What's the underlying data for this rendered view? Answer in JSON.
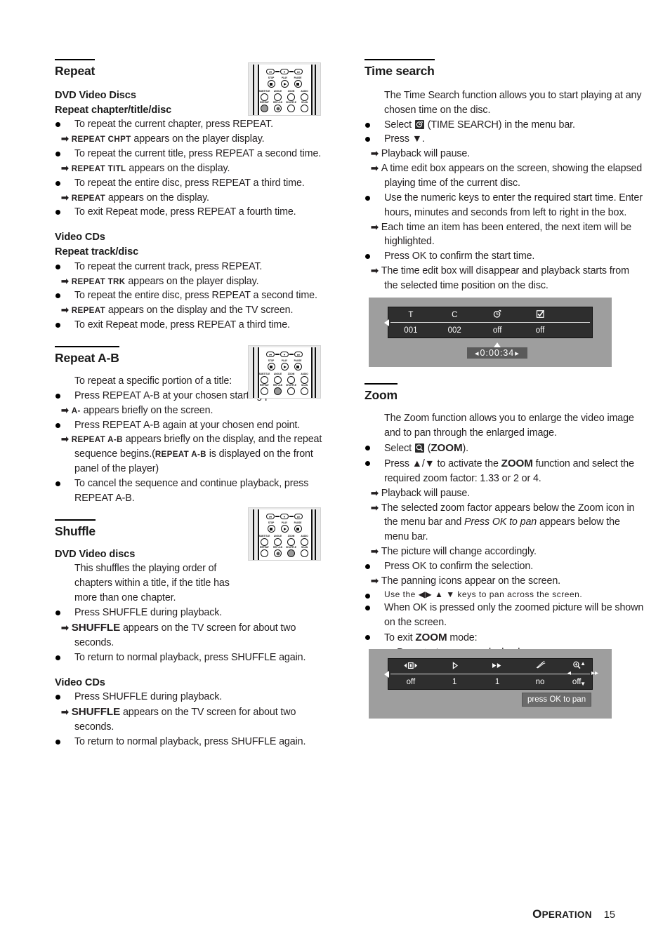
{
  "footer": {
    "section": "PERATION",
    "section_cap": "O",
    "page_number": "15"
  },
  "left_column": {
    "repeat": {
      "heading": "Repeat",
      "dvd_sub1": "DVD Video Discs",
      "dvd_sub2": "Repeat chapter/title/disc",
      "items": [
        {
          "type": "bullet",
          "text": "To repeat the current chapter, press REPEAT."
        },
        {
          "type": "arrow",
          "disp": "REPEAT CHPT",
          "text": " appears on the player display."
        },
        {
          "type": "bullet",
          "text": "To repeat the current title, press REPEAT a second time."
        },
        {
          "type": "arrow",
          "disp": "REPEAT TITL",
          "text": " appears on the display."
        },
        {
          "type": "bullet",
          "text": "To repeat the entire disc, press REPEAT a third time."
        },
        {
          "type": "arrow",
          "disp": "REPEAT",
          "text": " appears on the display."
        },
        {
          "type": "bullet",
          "text": "To exit Repeat mode, press REPEAT a fourth time."
        }
      ],
      "vcd_sub1": "Video CDs",
      "vcd_sub2": "Repeat track/disc",
      "vcd_items": [
        {
          "type": "bullet",
          "text": "To repeat the current track, press REPEAT."
        },
        {
          "type": "arrow",
          "disp": "REPEAT TRK",
          "text": " appears on the player display."
        },
        {
          "type": "bullet",
          "text": "To repeat the entire disc, press REPEAT a second time."
        },
        {
          "type": "arrow",
          "disp": "REPEAT",
          "text": " appears on the display and the TV screen."
        },
        {
          "type": "bullet",
          "text": "To exit Repeat mode, press REPEAT a third time."
        }
      ]
    },
    "repeat_ab": {
      "heading": "Repeat A-B",
      "intro": "To repeat a specific portion of a title:",
      "b1": "Press REPEAT A-B at your chosen starting point.",
      "a1_disp": "A-",
      "a1_text": " appears briefly on the screen.",
      "b2": "Press REPEAT A-B again at your chosen end point.",
      "a2_disp": "REPEAT A-B",
      "a2_text": " appears briefly on the display, and the repeat sequence begins.(",
      "a2_disp2": "REPEAT A-B",
      "a2_text2": " is displayed on the front panel of the player)",
      "b3": "To cancel the sequence and continue playback, press REPEAT A-B."
    },
    "shuffle": {
      "heading": "Shuffle",
      "dvd_sub": "DVD Video discs",
      "dvd_intro": "This shuffles the playing order of chapters within a title, if the title has more than one chapter.",
      "dvd_b1": "Press SHUFFLE during playback.",
      "dvd_a1_disp": "SHUFFLE",
      "dvd_a1_text": " appears on the TV screen for about two seconds.",
      "dvd_b2": "To return to normal playback, press SHUFFLE again.",
      "vcd_sub": "Video CDs",
      "vcd_b1": "Press SHUFFLE during playback.",
      "vcd_a1_disp": "SHUFFLE",
      "vcd_a1_text": " appears on the TV screen for about two seconds.",
      "vcd_b2": "To return to normal playback, press SHUFFLE again."
    }
  },
  "right_column": {
    "time_search": {
      "heading": "Time search",
      "intro": "The Time Search function allows you to start playing at any chosen time on the disc.",
      "b1_pre": "Select ",
      "b1_post": " (TIME SEARCH) in the menu bar.",
      "b2": "Press ▼.",
      "a1": "Playback will pause.",
      "a2": "A time edit box appears on the screen, showing the elapsed playing time of the current disc.",
      "b3": "Use the numeric keys to enter the required start time. Enter hours, minutes and seconds from left to right in the box.",
      "a3": "Each time an item has been entered, the next item will be highlighted.",
      "b4": "Press OK to confirm the start time.",
      "a4": "The time edit box will disappear and playback starts from the selected time position on the disc."
    },
    "zoom": {
      "heading": "Zoom",
      "intro": "The Zoom function allows you to enlarge the video image and to pan through the enlarged image.",
      "b1_pre": "Select ",
      "b1_mid": "ZOOM",
      "b1_post": ").",
      "b1_paren": " (",
      "b2_pre": "Press ▲/▼ to activate the ",
      "b2_bold": "ZOOM",
      "b2_post": " function and select the required zoom factor: 1.33 or 2 or 4.",
      "a1": "Playback will pause.",
      "a2_pre": "The selected zoom factor appears below the Zoom icon in the menu bar and ",
      "a2_ital": "Press OK to pan",
      "a2_post": " appears below the menu bar.",
      "a3": "The picture will change accordingly.",
      "b3": "Press OK to confirm the selection.",
      "a4": "The panning icons appear on the screen.",
      "b4": "Use the ◀▶ ▲ ▼ keys to pan across the screen.",
      "b5": "When OK is pressed only the zoomed picture will be shown on the screen.",
      "b6_pre": "To exit ",
      "b6_bold": "ZOOM",
      "b6_post": " mode:",
      "d1": "Press ▶ to resume playback."
    }
  },
  "figures": {
    "timesearch_osd": {
      "columns": [
        {
          "icon": "title-icon",
          "icon_text": "T",
          "value": "001"
        },
        {
          "icon": "chapter-icon",
          "icon_text": "C",
          "value": "002"
        },
        {
          "icon": "time-search-icon",
          "icon_text": "",
          "value": "off"
        },
        {
          "icon": "marker-icon",
          "icon_text": "",
          "value": "off"
        }
      ],
      "time_edit_value": "0:00:34"
    },
    "zoom_osd": {
      "columns": [
        {
          "icon": "sound-icon",
          "value": "off"
        },
        {
          "icon": "subtitle-icon",
          "value": "1"
        },
        {
          "icon": "audio-language-icon",
          "value": "1"
        },
        {
          "icon": "camera-angle-icon",
          "value": "no"
        },
        {
          "icon": "zoom-icon",
          "value": "off"
        }
      ],
      "hint_label": "press OK to pan"
    }
  },
  "remotes": {
    "top_row_labels": [
      "PREV",
      "OPEN",
      "NEXT"
    ],
    "mid_row_labels": [
      "STOP",
      "PLAY",
      "PAUSE"
    ],
    "row3_labels": [
      "SUBTITLE",
      "ANGLE",
      "ZOOM",
      "AUDIO"
    ],
    "row4_labels": [
      "REPEAT",
      "REPEAT A-B",
      "SHUFFLE",
      "SCAN"
    ]
  },
  "colors": {
    "osd_bar_bg": "#2e2e2e",
    "osd_fig_bg": "#9e9e9e",
    "time_box_bg": "#5a5a5a",
    "remote_bg": "#e9e9e9",
    "highlight_btn": "#9a9a9a"
  }
}
